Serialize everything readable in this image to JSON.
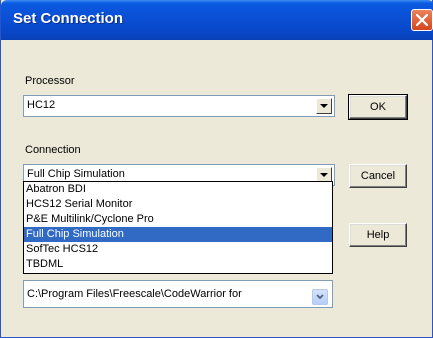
{
  "window": {
    "title": "Set Connection"
  },
  "processor": {
    "label": "Processor",
    "value": "HC12"
  },
  "connection": {
    "label": "Connection",
    "value": "Full Chip Simulation",
    "options": [
      "Abatron BDI",
      "HCS12 Serial Monitor",
      "P&E Multilink/Cyclone Pro",
      "Full Chip Simulation",
      "SofTec HCS12",
      "TBDML"
    ],
    "selected_option": "Full Chip Simulation"
  },
  "buttons": {
    "ok": "OK",
    "cancel": "Cancel",
    "help": "Help"
  },
  "path_field": {
    "value": "C:\\Program Files\\Freescale\\CodeWarrior for"
  },
  "icons": {
    "close": "close-icon",
    "dropdown_arrow": "chevron-down-icon"
  },
  "colors": {
    "titlebar": "#0a4fd4",
    "selection": "#316ac5",
    "dialog_bg": "#ece9d8"
  }
}
